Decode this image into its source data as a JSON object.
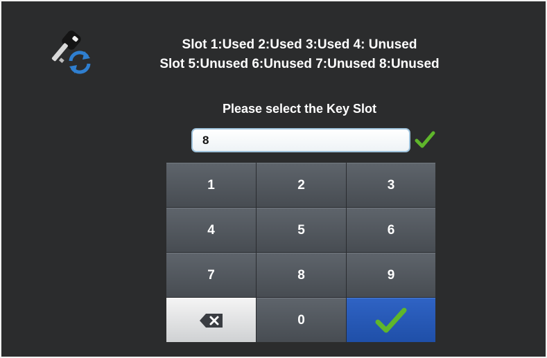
{
  "header": {
    "slot_status_line1": "Slot 1:Used 2:Used 3:Used 4: Unused",
    "slot_status_line2": "Slot 5:Unused 6:Unused 7:Unused 8:Unused"
  },
  "prompt": "Please select the Key Slot",
  "entry": {
    "value": "8",
    "confirm_icon": "checkmark-icon"
  },
  "keypad": {
    "k1": "1",
    "k2": "2",
    "k3": "3",
    "k4": "4",
    "k5": "5",
    "k6": "6",
    "k7": "7",
    "k8": "8",
    "k9": "9",
    "k0": "0",
    "backspace_icon": "backspace-icon",
    "enter_icon": "checkmark-icon"
  },
  "colors": {
    "background": "#2b2c2d",
    "key": "#54595f",
    "enter_key": "#2856b5",
    "check_green": "#5fb62b"
  }
}
